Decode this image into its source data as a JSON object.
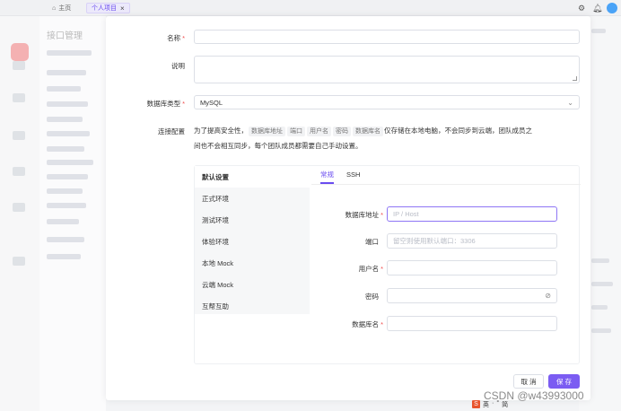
{
  "topbar": {
    "home_tab": "主页",
    "active_tab": "个人项目",
    "close_glyph": "×"
  },
  "background": {
    "title": "接口管理"
  },
  "modal": {
    "name": {
      "label": "名称",
      "value": ""
    },
    "description": {
      "label": "说明",
      "value": ""
    },
    "db_type": {
      "label": "数据库类型",
      "value": "MySQL"
    },
    "connection": {
      "label": "连接配置",
      "notice": {
        "prefix": "为了提高安全性，",
        "chips": [
          "数据库地址",
          "端口",
          "用户名",
          "密码",
          "数据库名"
        ],
        "suffix_1": "仅存储在本地电脑，不会同步到云端，团队成员之",
        "suffix_2": "间也不会相互同步，每个团队成员都需要自己手动设置。"
      }
    },
    "environments": [
      "默认设置",
      "正式环境",
      "测试环境",
      "体验环境",
      "本地 Mock",
      "云端 Mock",
      "互帮互助"
    ],
    "tabs": [
      "常规",
      "SSH"
    ],
    "fields": {
      "host": {
        "label": "数据库地址",
        "placeholder": "IP / Host"
      },
      "port": {
        "label": "端口",
        "placeholder": "留空则使用默认端口：3306"
      },
      "user": {
        "label": "用户名",
        "placeholder": ""
      },
      "password": {
        "label": "密码",
        "placeholder": ""
      },
      "db_name": {
        "label": "数据库名",
        "placeholder": ""
      }
    },
    "buttons": {
      "cancel": "取 消",
      "save": "保 存"
    }
  },
  "watermark": "CSDN @w43993000",
  "ime_bar": [
    "英",
    "·",
    "°",
    "简"
  ],
  "colors": {
    "accent": "#6a4cf0",
    "primary_button": "#7b5cf2",
    "required": "#f04d4d"
  }
}
